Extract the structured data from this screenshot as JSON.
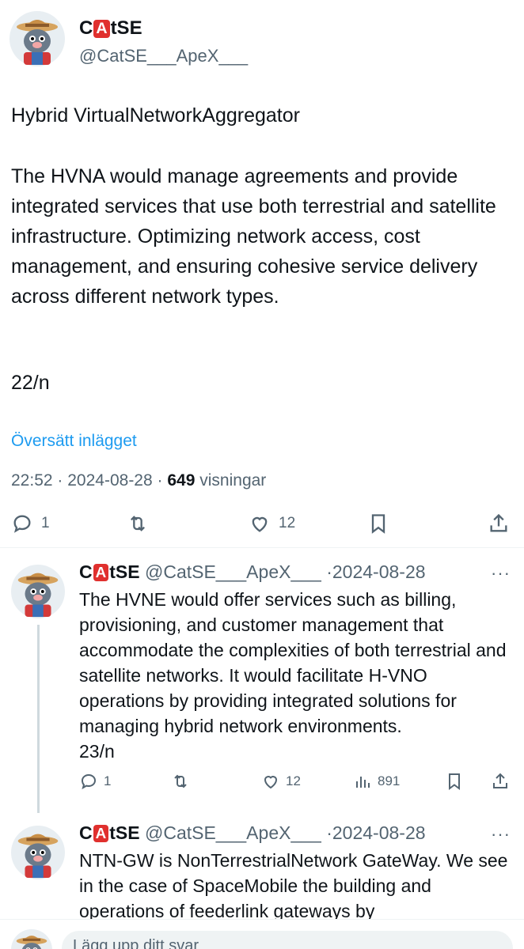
{
  "main_tweet": {
    "author_name_pre": "C",
    "author_name_badge": "A",
    "author_name_post": "tSE",
    "handle": "@CatSE___ApeX___",
    "title": "Hybrid VirtualNetworkAggregator",
    "body": "The HVNA would manage agreements and provide integrated services that use both terrestrial and satellite infrastructure. Optimizing network access, cost management, and ensuring cohesive service delivery across different network types.",
    "number": "22/n",
    "translate_label": "Översätt inlägget",
    "time": "22:52",
    "date": "2024-08-28",
    "views": "649",
    "views_label": "visningar",
    "actions": {
      "reply_icon": "reply-icon",
      "reply_count": "1",
      "retweet_icon": "retweet-icon",
      "like_icon": "heart-icon",
      "like_count": "12",
      "bookmark_icon": "bookmark-icon",
      "share_icon": "share-icon"
    }
  },
  "replies": [
    {
      "author_name_pre": "C",
      "author_name_badge": "A",
      "author_name_post": "tSE",
      "handle": "@CatSE___ApeX___",
      "date": "2024-08-28",
      "body": "The HVNE would offer services such as billing, provisioning, and customer management that accommodate the complexities of both terrestrial and satellite networks. It would facilitate H-VNO operations by providing integrated solutions for managing hybrid network environments.",
      "number": "23/n",
      "reply_count": "1",
      "like_count": "12",
      "views_count": "891"
    },
    {
      "author_name_pre": "C",
      "author_name_badge": "A",
      "author_name_post": "tSE",
      "handle": "@CatSE___ApeX___",
      "date": "2024-08-28",
      "body": "NTN-GW is NonTerrestrialNetwork GateWay. We see in the case of SpaceMobile the building and operations of feederlink gateways by"
    }
  ],
  "separator": "·",
  "more_label": "···",
  "composer": {
    "placeholder": "Lägg upp ditt svar"
  },
  "colors": {
    "accent": "#1d9bf0",
    "muted": "#536471",
    "badge_red": "#e0302e"
  }
}
